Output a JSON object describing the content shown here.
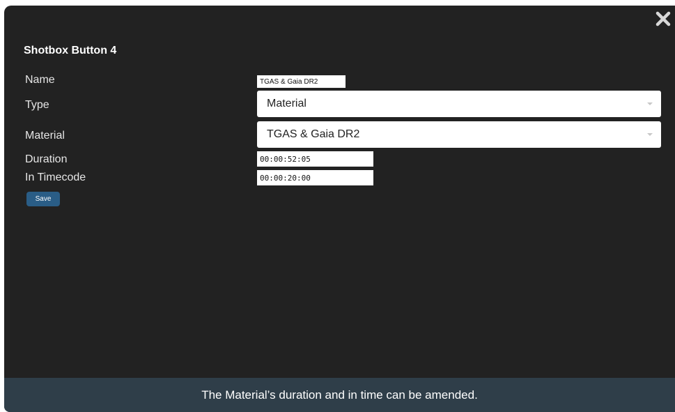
{
  "dialog": {
    "title": "Shotbox Button 4",
    "close_icon": "close-icon"
  },
  "form": {
    "name_label": "Name",
    "name_value": "TGAS & Gaia DR2",
    "type_label": "Type",
    "type_value": "Material",
    "material_label": "Material",
    "material_value": "TGAS & Gaia DR2",
    "duration_label": "Duration",
    "duration_value": "00:00:52:05",
    "in_timecode_label": "In Timecode",
    "in_timecode_value": "00:00:20:00",
    "save_label": "Save"
  },
  "caption": {
    "text": "The Material’s duration and in time can be amended."
  }
}
